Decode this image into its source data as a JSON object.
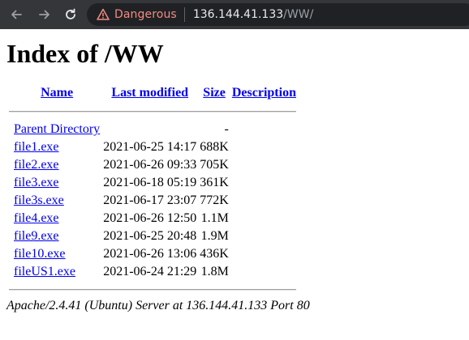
{
  "browser": {
    "security_label": "Dangerous",
    "url_host": "136.144.41.133",
    "url_path": "/WW/",
    "colors": {
      "danger": "#f28b82",
      "toolbar": "#35363a",
      "omnibox": "#202124"
    }
  },
  "page": {
    "title": "Index of /WW",
    "columns": {
      "name": "Name",
      "modified": "Last modified",
      "size": "Size",
      "description": "Description"
    },
    "parent": {
      "name": "Parent Directory",
      "modified": "",
      "size": "-"
    },
    "rows": [
      {
        "name": "file1.exe",
        "modified": "2021-06-25 14:17",
        "size": "688K"
      },
      {
        "name": "file2.exe",
        "modified": "2021-06-26 09:33",
        "size": "705K"
      },
      {
        "name": "file3.exe",
        "modified": "2021-06-18 05:19",
        "size": "361K"
      },
      {
        "name": "file3s.exe",
        "modified": "2021-06-17 23:07",
        "size": "772K"
      },
      {
        "name": "file4.exe",
        "modified": "2021-06-26 12:50",
        "size": "1.1M"
      },
      {
        "name": "file9.exe",
        "modified": "2021-06-25 20:48",
        "size": "1.9M"
      },
      {
        "name": "file10.exe",
        "modified": "2021-06-26 13:06",
        "size": "436K"
      },
      {
        "name": "fileUS1.exe",
        "modified": "2021-06-24 21:29",
        "size": "1.8M"
      }
    ],
    "footer": "Apache/2.4.41 (Ubuntu) Server at 136.144.41.133 Port 80"
  }
}
